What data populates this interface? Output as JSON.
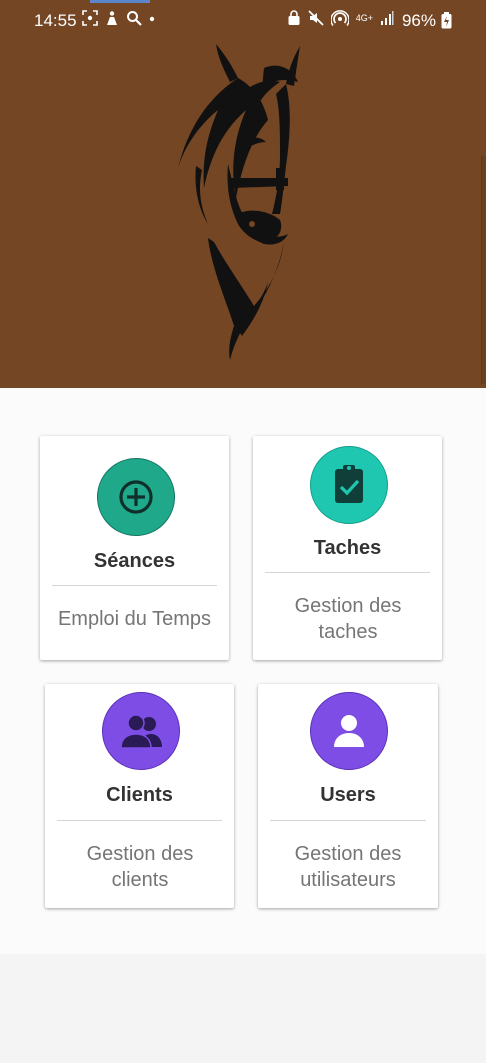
{
  "status_bar": {
    "time": "14:55",
    "battery": "96%",
    "network": "4G+"
  },
  "colors": {
    "header_bg": "#744624",
    "teal": "#1fa88a",
    "teal_light": "#1fc7b0",
    "purple": "#7e4de6"
  },
  "cards": [
    {
      "title": "Séances",
      "desc": "Emploi du Temps",
      "icon": "add-circle-icon"
    },
    {
      "title": "Taches",
      "desc": "Gestion des taches",
      "icon": "clipboard-check-icon"
    },
    {
      "title": "Clients",
      "desc": "Gestion des clients",
      "icon": "group-icon"
    },
    {
      "title": "Users",
      "desc": "Gestion des utilisateurs",
      "icon": "person-icon"
    }
  ]
}
